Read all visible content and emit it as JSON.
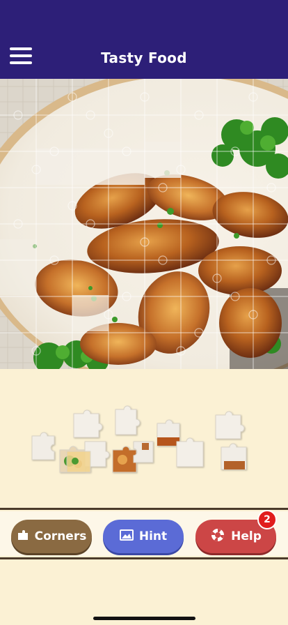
{
  "header": {
    "title": "Tasty Food",
    "bg_color": "#2d1f78"
  },
  "menu": {
    "icon": "hamburger-menu-icon"
  },
  "board": {
    "image_subject": "roasted-chicken-wings-with-parsley",
    "grid_columns": 8,
    "grid_rows": 8
  },
  "tray": {
    "pieces_visible": 12
  },
  "toolbar": {
    "corners_label": "Corners",
    "corners_icon": "corner-piece-icon",
    "hint_label": "Hint",
    "hint_icon": "image-icon",
    "help_label": "Help",
    "help_icon": "lifebuoy-icon",
    "help_badge": "2",
    "colors": {
      "corners": "#8a6a42",
      "hint": "#5b6bd6",
      "help": "#cc4646",
      "badge": "#e11d1d"
    }
  }
}
